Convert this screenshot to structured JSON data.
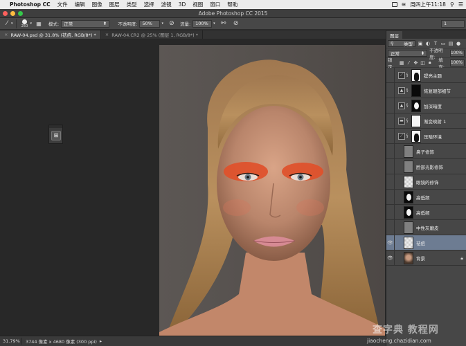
{
  "menubar": {
    "app": "Photoshop CC",
    "items": [
      "文件",
      "编辑",
      "图像",
      "图层",
      "类型",
      "选择",
      "滤镜",
      "3D",
      "视图",
      "窗口",
      "帮助"
    ],
    "clock": "周四上午11:18"
  },
  "titlebar": {
    "title": "Adobe Photoshop CC 2015"
  },
  "options": {
    "brush_size": "250",
    "mode_label": "模式:",
    "mode_value": "正常",
    "opacity_label": "不透明度:",
    "opacity_value": "50%",
    "flow_label": "流量:",
    "flow_value": "100%",
    "right_value": "1"
  },
  "tabs": [
    {
      "label": "RAW-04.psd @ 31.8% (祛痘, RGB/8*) *",
      "active": true
    },
    {
      "label": "RAW-04.CR2 @ 25% (图层 1, RGB/8*) *",
      "active": false
    }
  ],
  "status": {
    "zoom": "31.79%",
    "docinfo": "3744 像素 x 4680 像素 (300 ppi)"
  },
  "layers_panel": {
    "tab_label": "图层",
    "filter_value": "类型",
    "blend_value": "正常",
    "opacity_label": "不透明度:",
    "opacity_value": "100%",
    "lock_label": "锁定:",
    "fill_label": "填充:",
    "fill_value": "100%",
    "layers": [
      {
        "name": "提亮主题",
        "visible": false,
        "adjustment": "curves",
        "mask": "t-wb",
        "active": false,
        "locked": false
      },
      {
        "name": "恢复眼部细节",
        "visible": false,
        "adjustment": "levels",
        "mask": "t-black",
        "active": false,
        "locked": false
      },
      {
        "name": "加深暗度",
        "visible": false,
        "adjustment": "levels",
        "mask": "t-blob",
        "active": false,
        "locked": false
      },
      {
        "name": "渐变映射 1",
        "visible": false,
        "adjustment": "gradient",
        "mask": "t-white",
        "active": false,
        "locked": false
      },
      {
        "name": "压暗环境",
        "visible": false,
        "adjustment": "curves",
        "mask": "t-wb",
        "active": false,
        "locked": false
      },
      {
        "name": "鼻子修饰",
        "visible": false,
        "adjustment": "",
        "mask": "t-gray",
        "active": false,
        "locked": false
      },
      {
        "name": "脸部光影修饰",
        "visible": false,
        "adjustment": "",
        "mask": "t-gray",
        "active": false,
        "locked": false
      },
      {
        "name": "眼镜的修饰",
        "visible": false,
        "adjustment": "",
        "mask": "t-check",
        "active": false,
        "locked": false
      },
      {
        "name": "高低频",
        "visible": false,
        "adjustment": "",
        "mask": "t-blob",
        "active": false,
        "locked": false
      },
      {
        "name": "高低频",
        "visible": false,
        "adjustment": "",
        "mask": "t-blob",
        "active": false,
        "locked": false
      },
      {
        "name": "中性灰磨皮",
        "visible": false,
        "adjustment": "",
        "mask": "t-gray",
        "active": false,
        "locked": false
      },
      {
        "name": "祛痘",
        "visible": true,
        "adjustment": "",
        "mask": "t-check",
        "active": true,
        "locked": false
      },
      {
        "name": "背景",
        "visible": true,
        "adjustment": "",
        "mask": "t-face",
        "active": false,
        "locked": true
      }
    ]
  },
  "watermark": {
    "brand": "查字典 教程网",
    "url": "jiaocheng.chazidian.com"
  },
  "colors": {
    "menubar_bg": "#ececec",
    "panel_bg": "#474747",
    "active_layer": "#6d7c92",
    "eyeshadow": "#e0502a"
  }
}
